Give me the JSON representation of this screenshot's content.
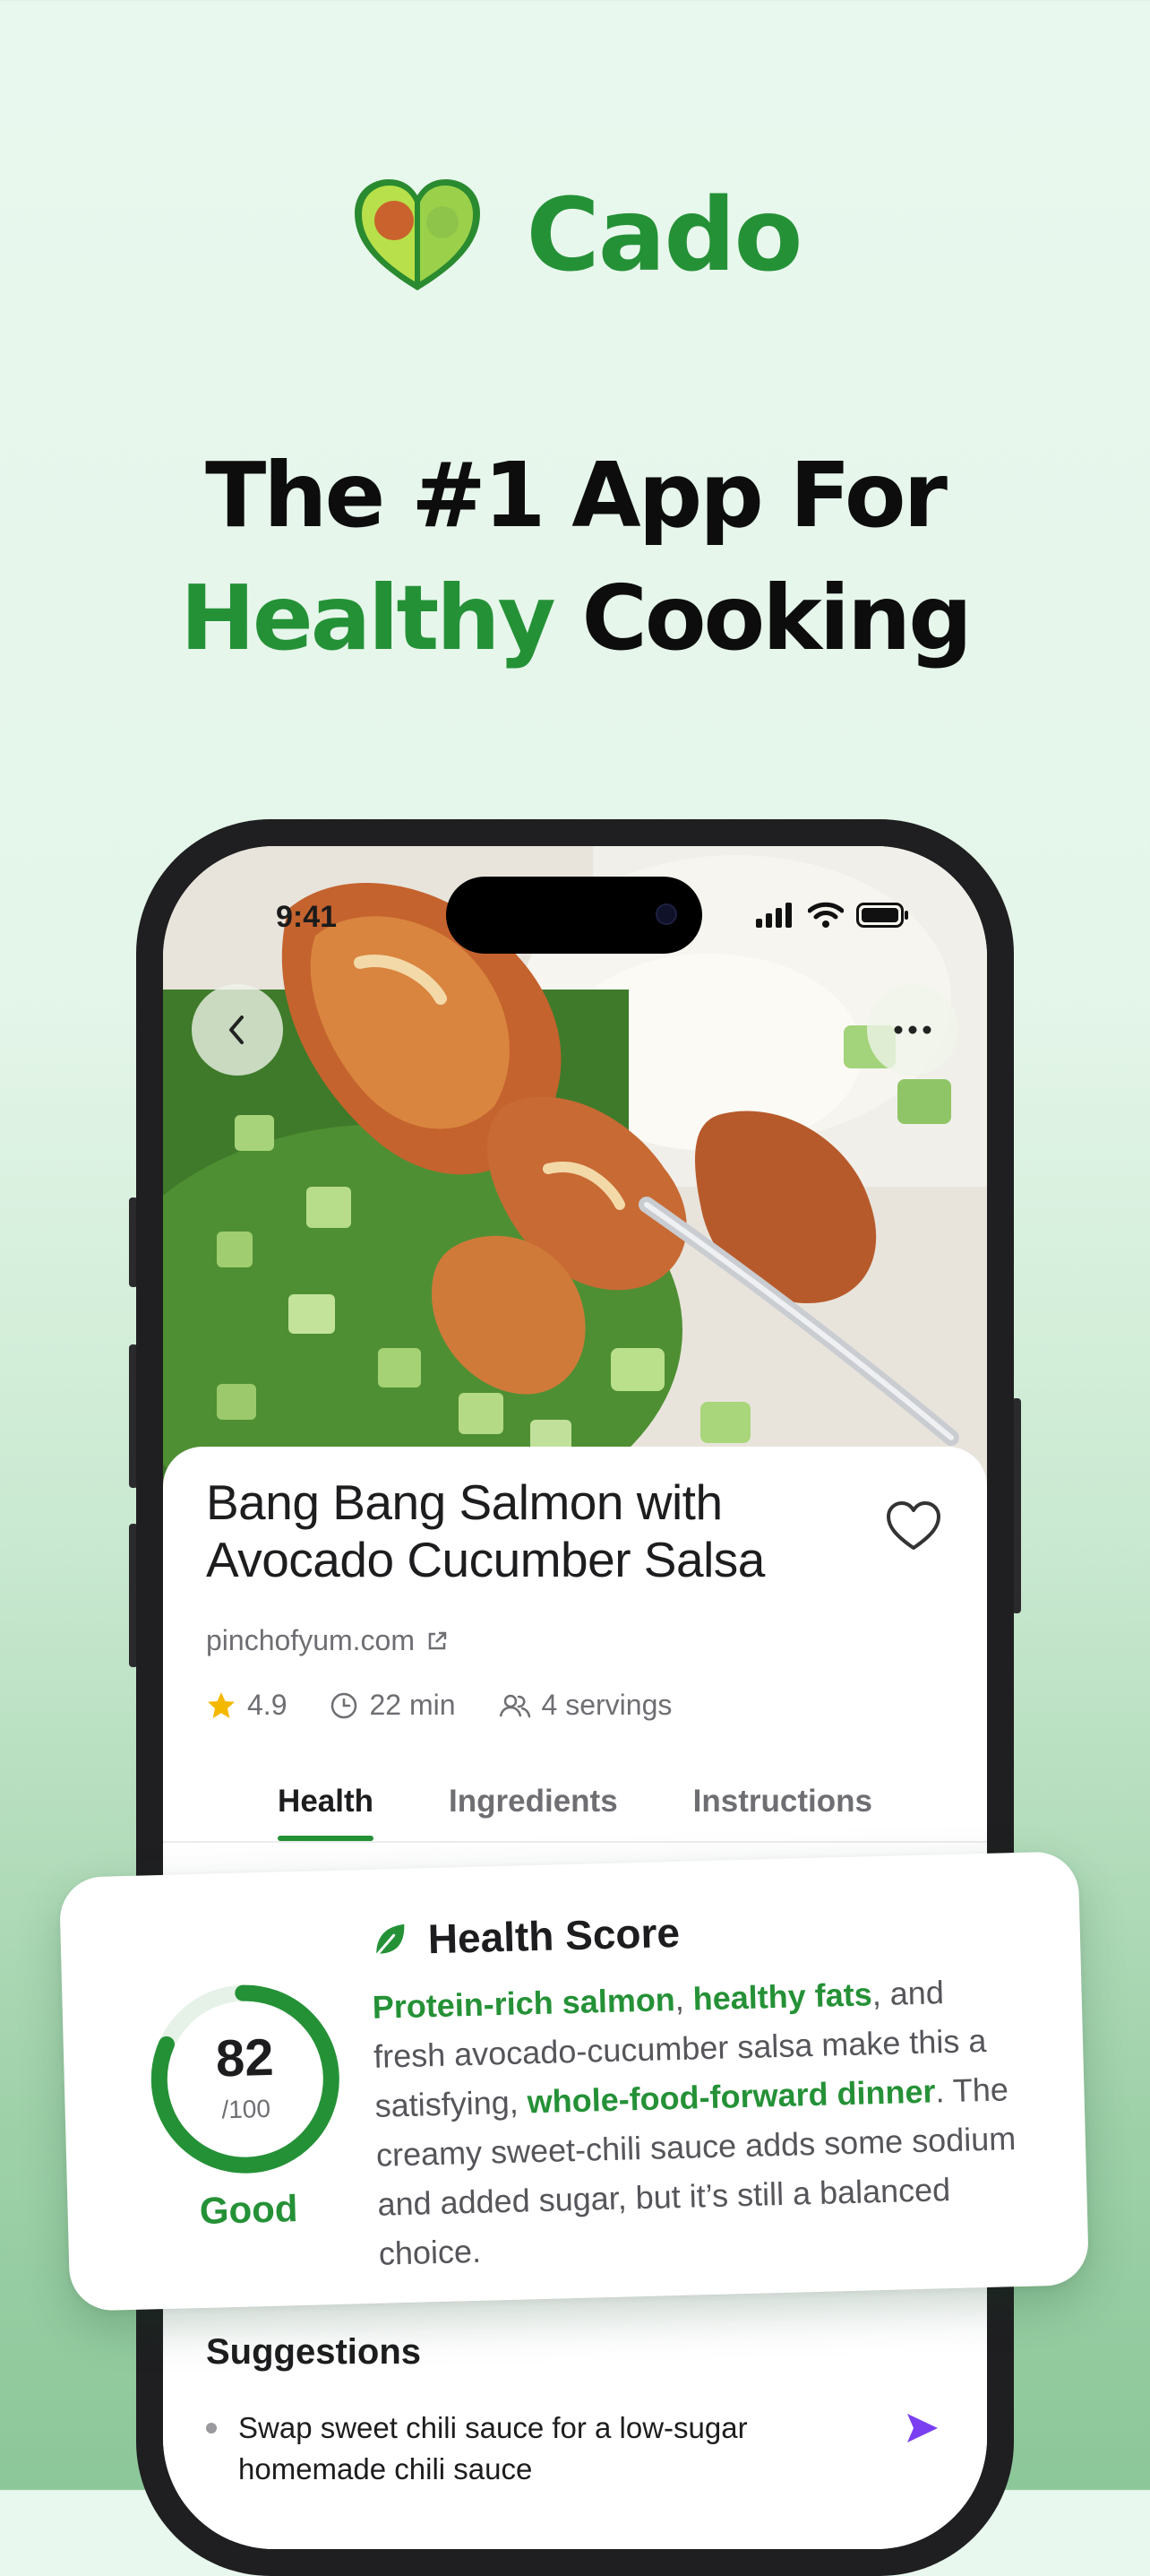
{
  "brand": {
    "name": "Cado",
    "accent_color": "#259137",
    "logo_icon": "avocado-heart-icon"
  },
  "headline": {
    "line1": "The #1 App For",
    "line2_accent": "Healthy",
    "line2_rest": " Cooking"
  },
  "status_bar": {
    "time": "9:41",
    "icons": [
      "signal-icon",
      "wifi-icon",
      "battery-icon"
    ]
  },
  "top_controls": {
    "back_icon": "chevron-left-icon",
    "more_icon": "ellipsis-icon"
  },
  "recipe": {
    "title": "Bang Bang Salmon with Avocado Cucumber Salsa",
    "source": "pinchofyum.com",
    "rating": "4.9",
    "time": "22 min",
    "servings": "4 servings"
  },
  "tabs": [
    {
      "label": "Health",
      "active": true
    },
    {
      "label": "Ingredients",
      "active": false
    },
    {
      "label": "Instructions",
      "active": false
    }
  ],
  "health_score": {
    "title": "Health Score",
    "score": "82",
    "out_of": "/100",
    "score_fraction": 0.82,
    "rating": "Good",
    "description": {
      "hl1": "Protein-rich salmon",
      "t1": ", ",
      "hl2": "healthy fats",
      "t2": ", and fresh avocado-cucumber salsa make this a satisfying, ",
      "hl3": "whole-food-forward dinner",
      "t3": ". The creamy sweet-chili sauce adds some sodium and added sugar, but it’s still a balanced choice."
    }
  },
  "suggestions": {
    "title": "Suggestions",
    "items": [
      {
        "text": "Swap sweet chili sauce for a low-sugar homemade chili sauce"
      }
    ]
  }
}
